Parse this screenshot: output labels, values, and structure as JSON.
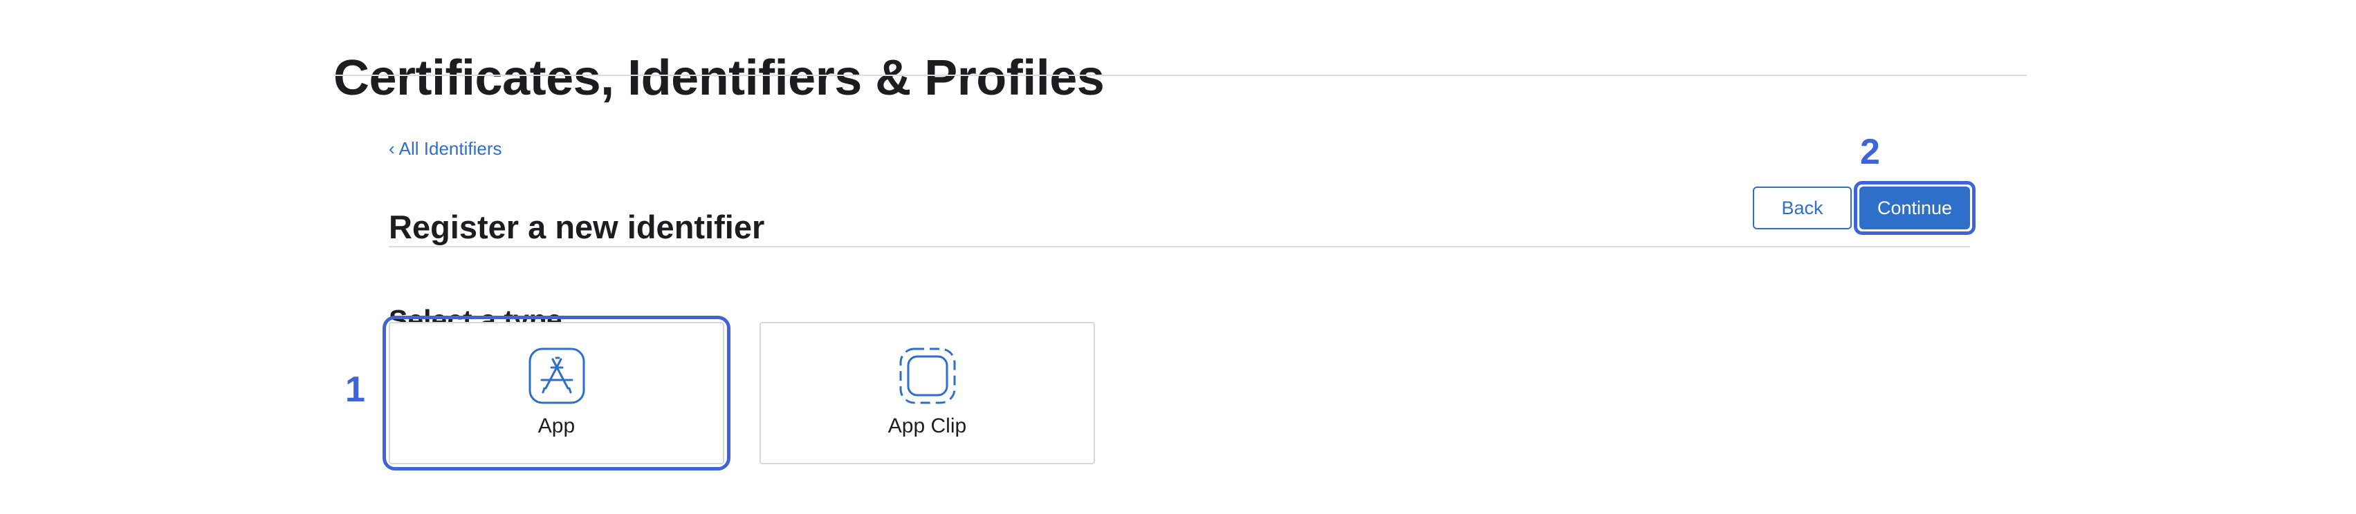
{
  "header": {
    "title": "Certificates, Identifiers & Profiles"
  },
  "nav": {
    "back_link_chevron": "‹",
    "back_link_label": "All Identifiers"
  },
  "form": {
    "heading": "Register a new identifier",
    "back_button": "Back",
    "continue_button": "Continue",
    "section_label": "Select a type",
    "types": [
      {
        "label": "App",
        "icon": "app-store-icon",
        "selected": true
      },
      {
        "label": "App Clip",
        "icon": "app-clip-icon",
        "selected": false
      }
    ]
  },
  "annotations": {
    "step_1": "1",
    "step_2": "2",
    "color": "#3f64d9"
  },
  "colors": {
    "accent": "#2d6fc9",
    "annotation": "#3f64d9",
    "text": "#1d1d1f",
    "divider": "#dcdcdc"
  }
}
